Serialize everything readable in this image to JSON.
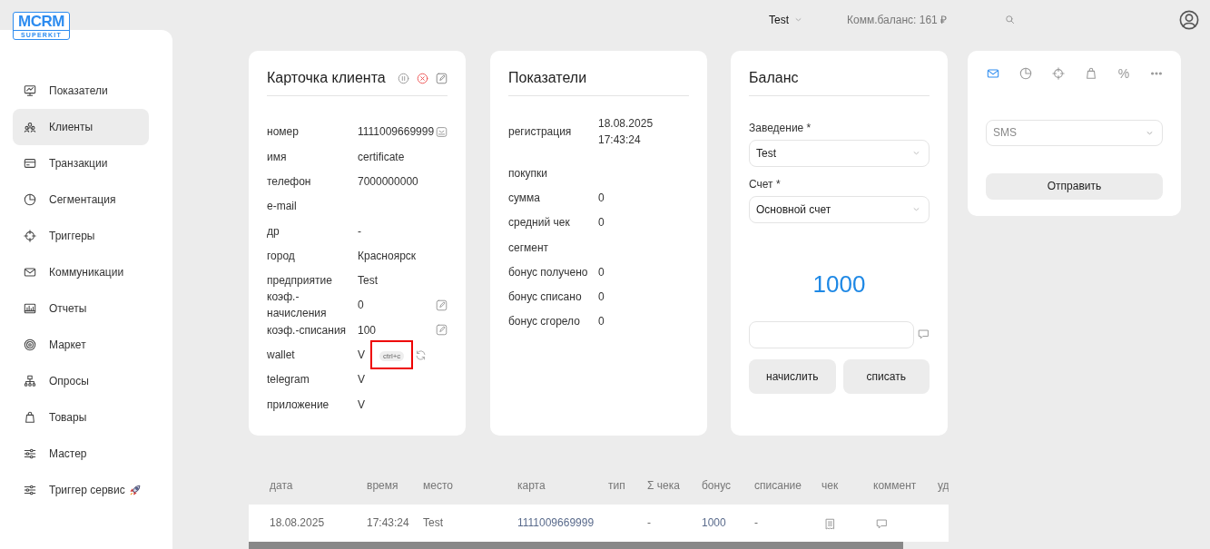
{
  "logo": {
    "title": "MCRM",
    "subtitle": "SUPERKIT"
  },
  "header": {
    "company": "Test",
    "balance": "Комм.баланс: 161 ₽"
  },
  "sidebar": {
    "items": [
      {
        "label": "Показатели",
        "selected": false
      },
      {
        "label": "Клиенты",
        "selected": true
      },
      {
        "label": "Транзакции",
        "selected": false
      },
      {
        "label": "Сегментация",
        "selected": false
      },
      {
        "label": "Триггеры",
        "selected": false
      },
      {
        "label": "Коммуникации",
        "selected": false
      },
      {
        "label": "Отчеты",
        "selected": false
      },
      {
        "label": "Маркет",
        "selected": false
      },
      {
        "label": "Опросы",
        "selected": false
      },
      {
        "label": "Товары",
        "selected": false
      },
      {
        "label": "Мастер",
        "selected": false
      },
      {
        "label": "Триггер сервис",
        "selected": false
      }
    ]
  },
  "client_card": {
    "title": "Карточка клиента",
    "fields": [
      {
        "kind": "copy",
        "label": "номер",
        "value": "1111009669999"
      },
      {
        "kind": "plain",
        "label": "имя",
        "value": "certificate"
      },
      {
        "kind": "plain",
        "label": "телефон",
        "value": "7000000000"
      },
      {
        "kind": "plain",
        "label": "e-mail"
      },
      {
        "kind": "plain",
        "label": "др",
        "value": "-"
      },
      {
        "kind": "plain",
        "label": "город",
        "value": "Красноярск"
      },
      {
        "kind": "plain",
        "label": "предприятие",
        "value": "Test"
      },
      {
        "kind": "edit",
        "label": "коэф.-начисления",
        "value": "0"
      },
      {
        "kind": "edit",
        "label": "коэф.-списания",
        "value": "100"
      },
      {
        "kind": "wallet",
        "label": "wallet",
        "value": "V",
        "badge": "ctrl+c",
        "highlighted": true
      },
      {
        "kind": "plain",
        "label": "telegram",
        "value": "V"
      },
      {
        "kind": "plain",
        "label": "приложение",
        "value": "V"
      }
    ]
  },
  "indicators_card": {
    "title": "Показатели",
    "groups": [
      [
        {
          "label": "регистрация",
          "value": "18.08.2025 17:43:24"
        }
      ],
      [
        {
          "label": "покупки"
        },
        {
          "label": "сумма",
          "value": "0"
        },
        {
          "label": "средний чек",
          "value": "0"
        },
        {
          "label": "сегмент"
        },
        {
          "label": "бонус получено",
          "value": "0"
        },
        {
          "label": "бонус списано",
          "value": "0"
        },
        {
          "label": "бонус сгорело",
          "value": "0"
        }
      ]
    ]
  },
  "balance_card": {
    "title": "Баланс",
    "selects": [
      {
        "label": "Заведение *",
        "value": "Test"
      },
      {
        "label": "Счет *",
        "value": "Основной счет"
      }
    ],
    "amount": "1000",
    "buttons": [
      "начислить",
      "списать"
    ]
  },
  "message_card": {
    "tabs": [
      {
        "selected": true
      },
      {
        "selected": false
      },
      {
        "selected": false
      },
      {
        "selected": false
      },
      {
        "label": "%",
        "selected": false
      },
      {
        "selected": false
      }
    ],
    "channel": "SMS",
    "button": "Отправить"
  },
  "table": {
    "columns": [
      "дата",
      "время",
      "место",
      "карта",
      "тип",
      "Σ чека",
      "бонус",
      "списание",
      "чек",
      "коммент",
      "уд"
    ],
    "rows": [
      {
        "cells": [
          {
            "kind": "text",
            "text": "18.08.2025"
          },
          {
            "kind": "text",
            "text": "17:43:24"
          },
          {
            "kind": "text",
            "text": "Test"
          },
          {
            "kind": "link",
            "text": "1111009669999"
          },
          {
            "kind": "empty"
          },
          {
            "kind": "text",
            "text": "-"
          },
          {
            "kind": "link",
            "text": "1000"
          },
          {
            "kind": "text",
            "text": "-"
          },
          {
            "kind": "receipt"
          },
          {
            "kind": "comment"
          }
        ]
      }
    ]
  }
}
